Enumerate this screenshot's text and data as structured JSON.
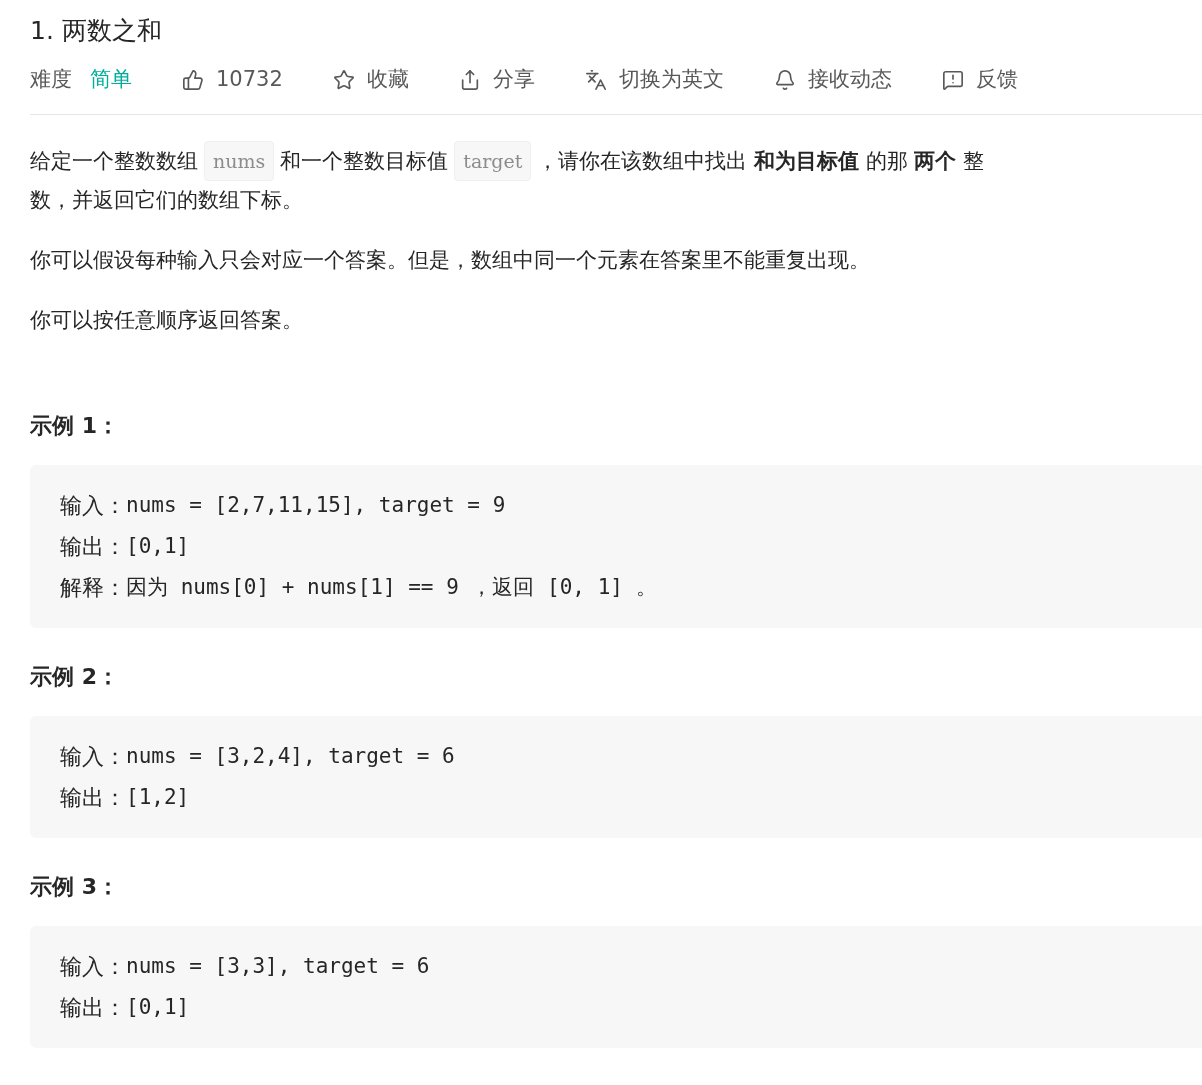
{
  "title": "1. 两数之和",
  "toolbar": {
    "difficulty_label": "难度",
    "difficulty": {
      "label": "简单",
      "kind": "easy"
    },
    "actions": [
      {
        "kind": "like",
        "label": "10732"
      },
      {
        "kind": "favorite",
        "label": "收藏"
      },
      {
        "kind": "share",
        "label": "分享"
      },
      {
        "kind": "translate",
        "label": "切换为英文"
      },
      {
        "kind": "notify",
        "label": "接收动态"
      },
      {
        "kind": "feedback",
        "label": "反馈"
      }
    ]
  },
  "description": [
    [
      [
        {
          "kind": "text",
          "text": "给定一个整数数组"
        },
        {
          "kind": "code",
          "text": "nums"
        },
        {
          "kind": "text",
          "text": "和一个整数目标值"
        },
        {
          "kind": "code",
          "text": "target"
        },
        {
          "kind": "text",
          "text": "，请你在该数组中找出 **和为目标值** 的那 **两个** 整"
        }
      ],
      [
        {
          "kind": "text",
          "text": "数，并返回它们的数组下标。"
        }
      ]
    ],
    [
      [
        {
          "kind": "text",
          "text": "你可以假设每种输入只会对应一个答案。但是，数组中同一个元素在答案里不能重复出现。"
        }
      ]
    ],
    [
      [
        {
          "kind": "text",
          "text": "你可以按任意顺序返回答案。"
        }
      ]
    ]
  ],
  "examples": [
    {
      "heading": "示例 1：",
      "lines": [
        {
          "label": "输入：",
          "value": "nums = [2,7,11,15], target = 9"
        },
        {
          "label": "输出：",
          "value": "[0,1]"
        },
        {
          "label": "解释：",
          "value": "因为 nums[0] + nums[1] == 9 ，返回 [0, 1] 。"
        }
      ]
    },
    {
      "heading": "示例 2：",
      "lines": [
        {
          "label": "输入：",
          "value": "nums = [3,2,4], target = 6"
        },
        {
          "label": "输出：",
          "value": "[1,2]"
        }
      ]
    },
    {
      "heading": "示例 3：",
      "lines": [
        {
          "label": "输入：",
          "value": "nums = [3,3], target = 6"
        },
        {
          "label": "输出：",
          "value": "[0,1]"
        }
      ]
    }
  ]
}
